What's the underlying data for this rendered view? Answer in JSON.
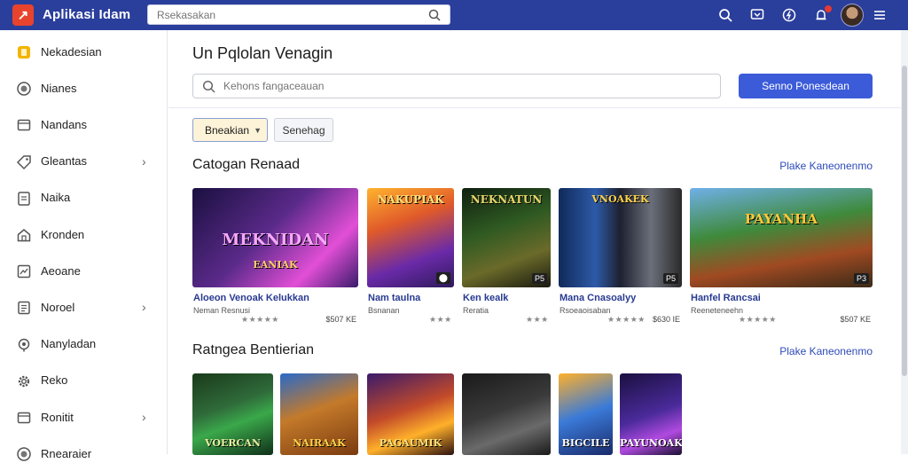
{
  "app": {
    "title": "Aplikasi Idam",
    "logo_glyph": "↗"
  },
  "top_search": {
    "value": "",
    "placeholder": "Rsekasakan"
  },
  "sidebar": {
    "items": [
      {
        "label": "Nekadesian",
        "icon": "folder-icon",
        "chevron": false
      },
      {
        "label": "Nianes",
        "icon": "circle-icon",
        "chevron": false
      },
      {
        "label": "Nandans",
        "icon": "box-icon",
        "chevron": false
      },
      {
        "label": "Gleantas",
        "icon": "tag-icon",
        "chevron": true
      },
      {
        "label": "Naika",
        "icon": "doc-icon",
        "chevron": false
      },
      {
        "label": "Kronden",
        "icon": "home-icon",
        "chevron": false
      },
      {
        "label": "Aeoane",
        "icon": "chart-icon",
        "chevron": false
      },
      {
        "label": "Noroel",
        "icon": "note-icon",
        "chevron": true
      },
      {
        "label": "Nanyladan",
        "icon": "pin-icon",
        "chevron": false
      },
      {
        "label": "Reko",
        "icon": "gear-icon",
        "chevron": false
      },
      {
        "label": "Ronitit",
        "icon": "box-icon",
        "chevron": true
      },
      {
        "label": "Rnearaier",
        "icon": "circle-icon",
        "chevron": false
      }
    ]
  },
  "main": {
    "title": "Un Pqlolan Venagin",
    "search": {
      "placeholder": "Kehons fangaceauan"
    },
    "primary_button": "Senno Ponesdean",
    "filter_dropdown": "Bneakian",
    "filter_button": "Senehag",
    "sections": [
      {
        "title": "Catogan Renaad",
        "see_all": "Plake Kaneonenmo",
        "cards": [
          {
            "thumb_text": "MEKNIDAN",
            "thumb_sub": "EANIAK",
            "title": "Aloeon Venoak Kelukkan",
            "sub": "Neman Resnusi",
            "stars": "★★★★★",
            "price": "$507 KE",
            "badge": ""
          },
          {
            "thumb_text": "NAKUPIAK",
            "thumb_sub": "",
            "title": "Nam taulna",
            "sub": "Bsnanan",
            "stars": "★★★",
            "price": "",
            "badge": "⬤"
          },
          {
            "thumb_text": "NEKNATUN",
            "thumb_sub": "",
            "title": "Ken kealk",
            "sub": "Reratia",
            "stars": "★★★",
            "price": "",
            "badge": "P5"
          },
          {
            "thumb_text": "VNOAKEK",
            "thumb_sub": "",
            "title": "Mana Cnasoalyy",
            "sub": "Rsoeaoisaban",
            "stars": "★★★★★",
            "price": "$630 IE",
            "badge": "P5"
          },
          {
            "thumb_text": "PAYANHA",
            "thumb_sub": "",
            "title": "Hanfel Rancsai",
            "sub": "Reeneteneehn",
            "stars": "★★★★★",
            "price": "$507 KE",
            "badge": "P3"
          }
        ]
      },
      {
        "title": "Ratngea Bentierian",
        "see_all": "Plake Kaneonenmo",
        "cards": [
          {
            "thumb_text": "VOERCAN",
            "thumb_sub": "",
            "badge": ""
          },
          {
            "thumb_text": "NAIRAAK",
            "thumb_sub": "",
            "badge": ""
          },
          {
            "thumb_text": "PAGAUMIK",
            "thumb_sub": "",
            "badge": ""
          },
          {
            "thumb_text": "",
            "thumb_sub": "",
            "badge": ""
          },
          {
            "thumb_text": "BIGCILE",
            "thumb_sub": "",
            "badge": ""
          },
          {
            "thumb_text": "PAYUNOAK",
            "thumb_sub": "",
            "badge": ""
          }
        ]
      }
    ]
  },
  "colors": {
    "topbar": "#2a3e9c",
    "accent": "#3b5bd9",
    "link": "#2e4bb8"
  }
}
